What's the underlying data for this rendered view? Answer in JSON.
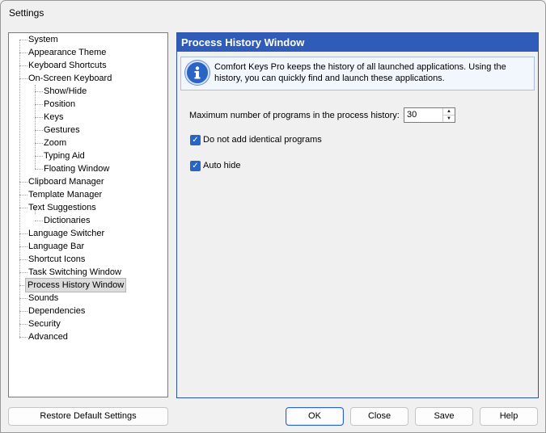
{
  "window": {
    "title": "Settings"
  },
  "tree": {
    "items": [
      {
        "label": "System"
      },
      {
        "label": "Appearance Theme"
      },
      {
        "label": "Keyboard Shortcuts"
      },
      {
        "label": "On-Screen Keyboard"
      },
      {
        "label": "Show/Hide"
      },
      {
        "label": "Position"
      },
      {
        "label": "Keys"
      },
      {
        "label": "Gestures"
      },
      {
        "label": "Zoom"
      },
      {
        "label": "Typing Aid"
      },
      {
        "label": "Floating Window"
      },
      {
        "label": "Clipboard Manager"
      },
      {
        "label": "Template Manager"
      },
      {
        "label": "Text Suggestions"
      },
      {
        "label": "Dictionaries"
      },
      {
        "label": "Language Switcher"
      },
      {
        "label": "Language Bar"
      },
      {
        "label": "Shortcut Icons"
      },
      {
        "label": "Task Switching Window"
      },
      {
        "label": "Process History Window"
      },
      {
        "label": "Sounds"
      },
      {
        "label": "Dependencies"
      },
      {
        "label": "Security"
      },
      {
        "label": "Advanced"
      }
    ],
    "selected": "Process History Window"
  },
  "panel": {
    "title": "Process History Window",
    "info_icon": "info-icon",
    "info_text": "Comfort Keys Pro keeps the history of all launched applications. Using the history, you can quickly find and launch these applications.",
    "max_label": "Maximum number of programs in the process history:",
    "max_value": "30",
    "option_identical": "Do not add identical programs",
    "option_identical_checked": true,
    "option_autohide": "Auto hide",
    "option_autohide_checked": true
  },
  "buttons": {
    "restore": "Restore Default Settings",
    "ok": "OK",
    "close": "Close",
    "save": "Save",
    "help": "Help"
  },
  "colors": {
    "accent": "#2e5cb8",
    "checkbox": "#2a64c4"
  }
}
